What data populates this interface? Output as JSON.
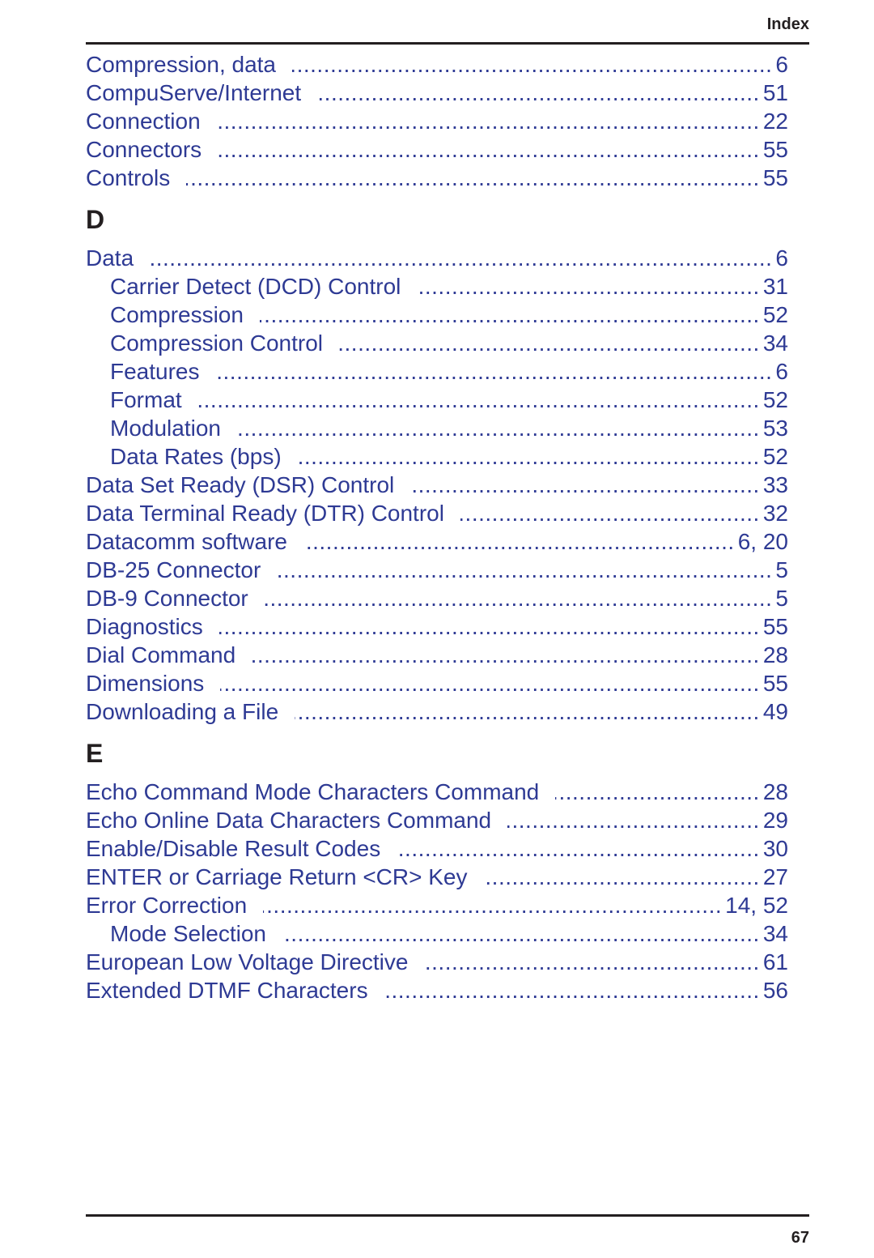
{
  "header": {
    "title": "Index"
  },
  "footer": {
    "page_number": "67"
  },
  "colors": {
    "entry_text": "#2e3a94",
    "heading_text": "#231f20"
  },
  "sections": [
    {
      "letter": "",
      "entries": [
        {
          "term": "Compression, data",
          "pages": "6",
          "level": 0
        },
        {
          "term": "CompuServe/Internet",
          "pages": "51",
          "level": 0
        },
        {
          "term": "Connection",
          "pages": "22",
          "level": 0
        },
        {
          "term": "Connectors",
          "pages": "55",
          "level": 0
        },
        {
          "term": "Controls",
          "pages": "55",
          "level": 0
        }
      ]
    },
    {
      "letter": "D",
      "entries": [
        {
          "term": "Data",
          "pages": "6",
          "level": 0
        },
        {
          "term": "Carrier Detect (DCD) Control",
          "pages": "31",
          "level": 1
        },
        {
          "term": "Compression",
          "pages": "52",
          "level": 1
        },
        {
          "term": "Compression Control",
          "pages": "34",
          "level": 1
        },
        {
          "term": "Features",
          "pages": "6",
          "level": 1
        },
        {
          "term": "Format",
          "pages": "52",
          "level": 1
        },
        {
          "term": "Modulation",
          "pages": "53",
          "level": 1
        },
        {
          "term": "Data Rates (bps)",
          "pages": "52",
          "level": 1
        },
        {
          "term": "Data Set Ready (DSR) Control",
          "pages": "33",
          "level": 0
        },
        {
          "term": "Data Terminal Ready (DTR) Control",
          "pages": "32",
          "level": 0
        },
        {
          "term": "Datacomm software",
          "pages": "6,  20",
          "level": 0
        },
        {
          "term": "DB-25 Connector",
          "pages": "5",
          "level": 0
        },
        {
          "term": "DB-9 Connector",
          "pages": "5",
          "level": 0
        },
        {
          "term": "Diagnostics",
          "pages": "55",
          "level": 0
        },
        {
          "term": "Dial Command",
          "pages": "28",
          "level": 0
        },
        {
          "term": "Dimensions",
          "pages": "55",
          "level": 0
        },
        {
          "term": "Downloading a File",
          "pages": "49",
          "level": 0
        }
      ]
    },
    {
      "letter": "E",
      "entries": [
        {
          "term": "Echo Command Mode Characters Command",
          "pages": "28",
          "level": 0
        },
        {
          "term": "Echo Online Data Characters Command",
          "pages": "29",
          "level": 0
        },
        {
          "term": "Enable/Disable Result Codes",
          "pages": "30",
          "level": 0
        },
        {
          "term": "ENTER or Carriage Return <CR> Key",
          "pages": "27",
          "level": 0
        },
        {
          "term": "Error Correction",
          "pages": "14,  52",
          "level": 0
        },
        {
          "term": "Mode Selection",
          "pages": "34",
          "level": 1
        },
        {
          "term": "European Low Voltage Directive",
          "pages": "61",
          "level": 0
        },
        {
          "term": "Extended DTMF Characters",
          "pages": "56",
          "level": 0
        }
      ]
    }
  ]
}
